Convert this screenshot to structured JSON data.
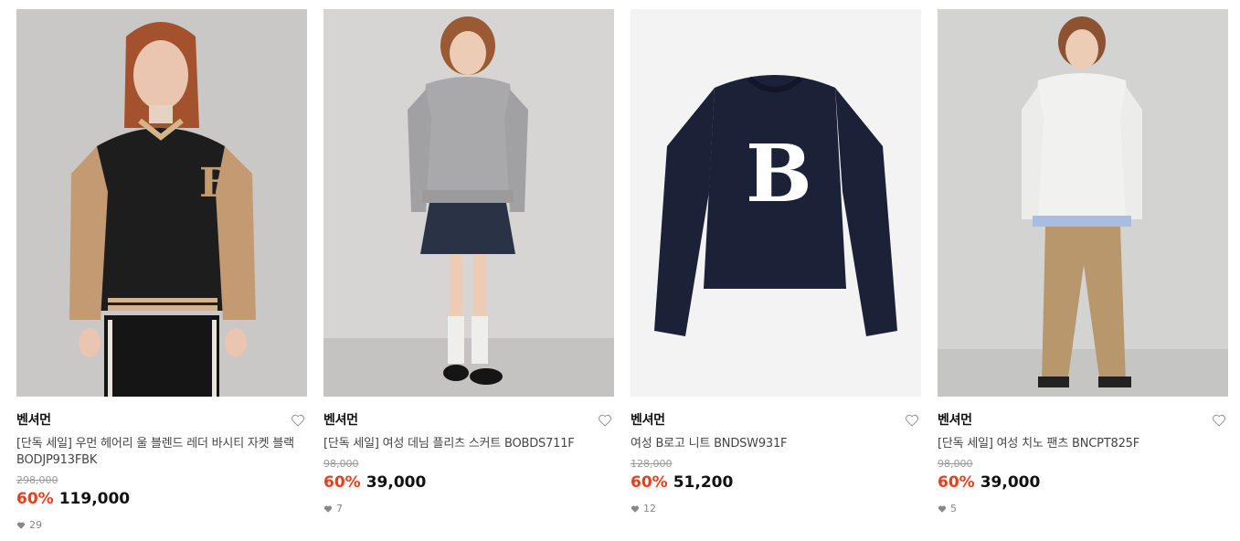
{
  "products": [
    {
      "brand": "벤셔먼",
      "name": "[단독 세일] 우먼 헤어리 울 블렌드 레더 바시티 자켓 블랙 BODJP913FBK",
      "original_price": "298,000",
      "discount": "60%",
      "price": "119,000",
      "likes": "29",
      "image": "varsity-jacket-model-photo",
      "bg_color": "#c9c8c6"
    },
    {
      "brand": "벤셔먼",
      "name": "[단독 세일] 여성 데님 플리츠 스커트 BOBDS711F",
      "original_price": "98,000",
      "discount": "60%",
      "price": "39,000",
      "likes": "7",
      "image": "denim-skirt-model-photo",
      "bg_color": "#d6d5d3"
    },
    {
      "brand": "벤셔먼",
      "name": "여성 B로고 니트 BNDSW931F",
      "original_price": "128,000",
      "discount": "60%",
      "price": "51,200",
      "likes": "12",
      "image": "navy-b-logo-knit-photo",
      "bg_color": "#f3f3f3"
    },
    {
      "brand": "벤셔먼",
      "name": "[단독 세일] 여성 치노 팬츠 BNCPT825F",
      "original_price": "98,000",
      "discount": "60%",
      "price": "39,000",
      "likes": "5",
      "image": "chino-pants-model-photo",
      "bg_color": "#d3d3d1"
    }
  ],
  "colors": {
    "discount": "#ee3a1e",
    "text": "#111111",
    "muted": "#9a9a9a"
  },
  "icons": {
    "wishlist": "heart-outline-icon",
    "likes": "heart-filled-icon"
  }
}
